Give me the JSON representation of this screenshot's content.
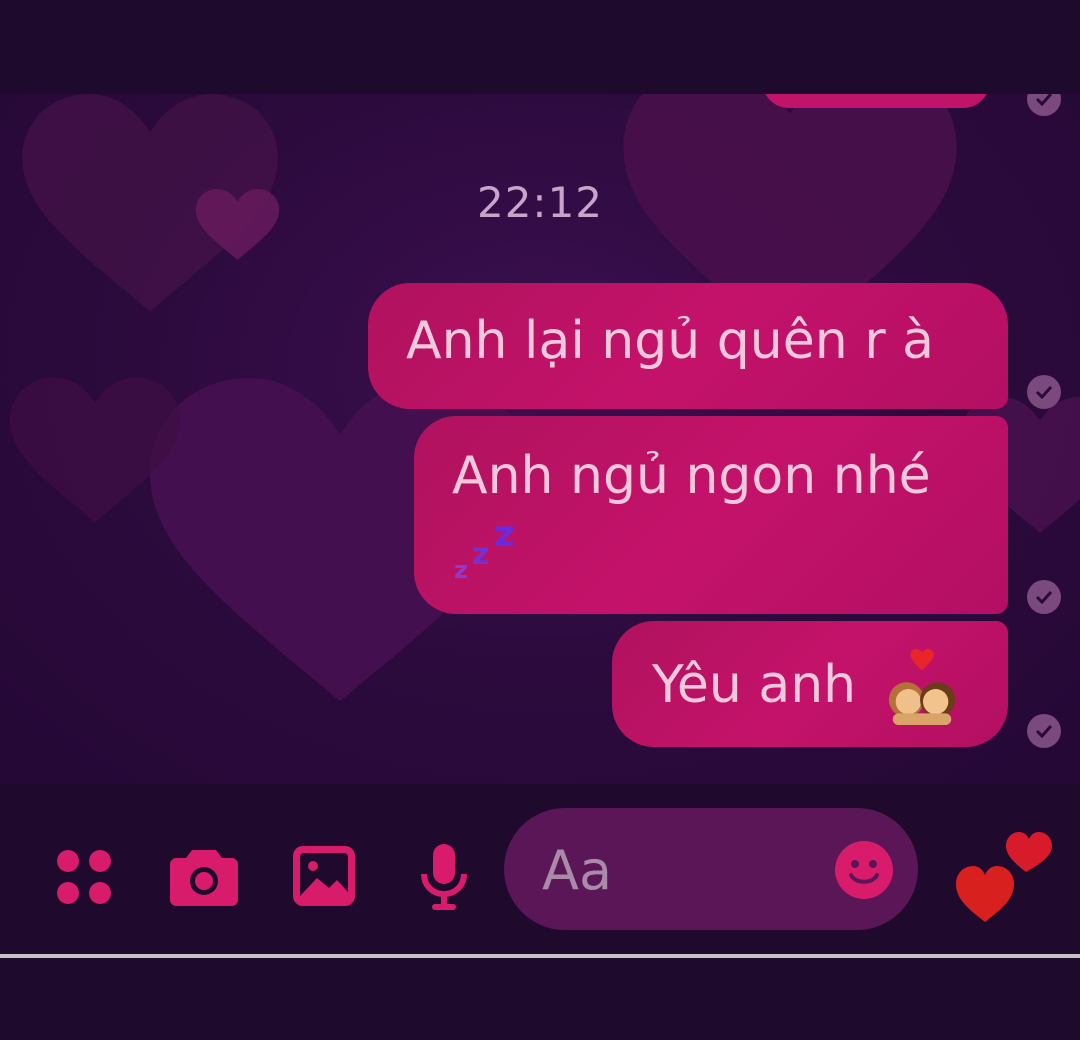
{
  "conversation": {
    "timestamp": "22:12",
    "messages": [
      {
        "text": "Anh lại ngủ quên r à",
        "status": "sent"
      },
      {
        "text": "Anh ngủ ngon nhé",
        "emoji": "zzz-emoji",
        "status": "sent"
      },
      {
        "text": "Yêu anh",
        "emoji": "couple-kiss-emoji",
        "status": "sent"
      }
    ]
  },
  "composer": {
    "placeholder": "Aa",
    "actions": [
      "grid-menu-icon",
      "camera-icon",
      "image-icon",
      "microphone-icon"
    ],
    "emoji_button": "smiley-icon",
    "quick_reaction": "hearts-icon"
  },
  "colors": {
    "bubble": "#c0136a",
    "accent": "#d81b6a",
    "background": "#2b0a3c"
  }
}
